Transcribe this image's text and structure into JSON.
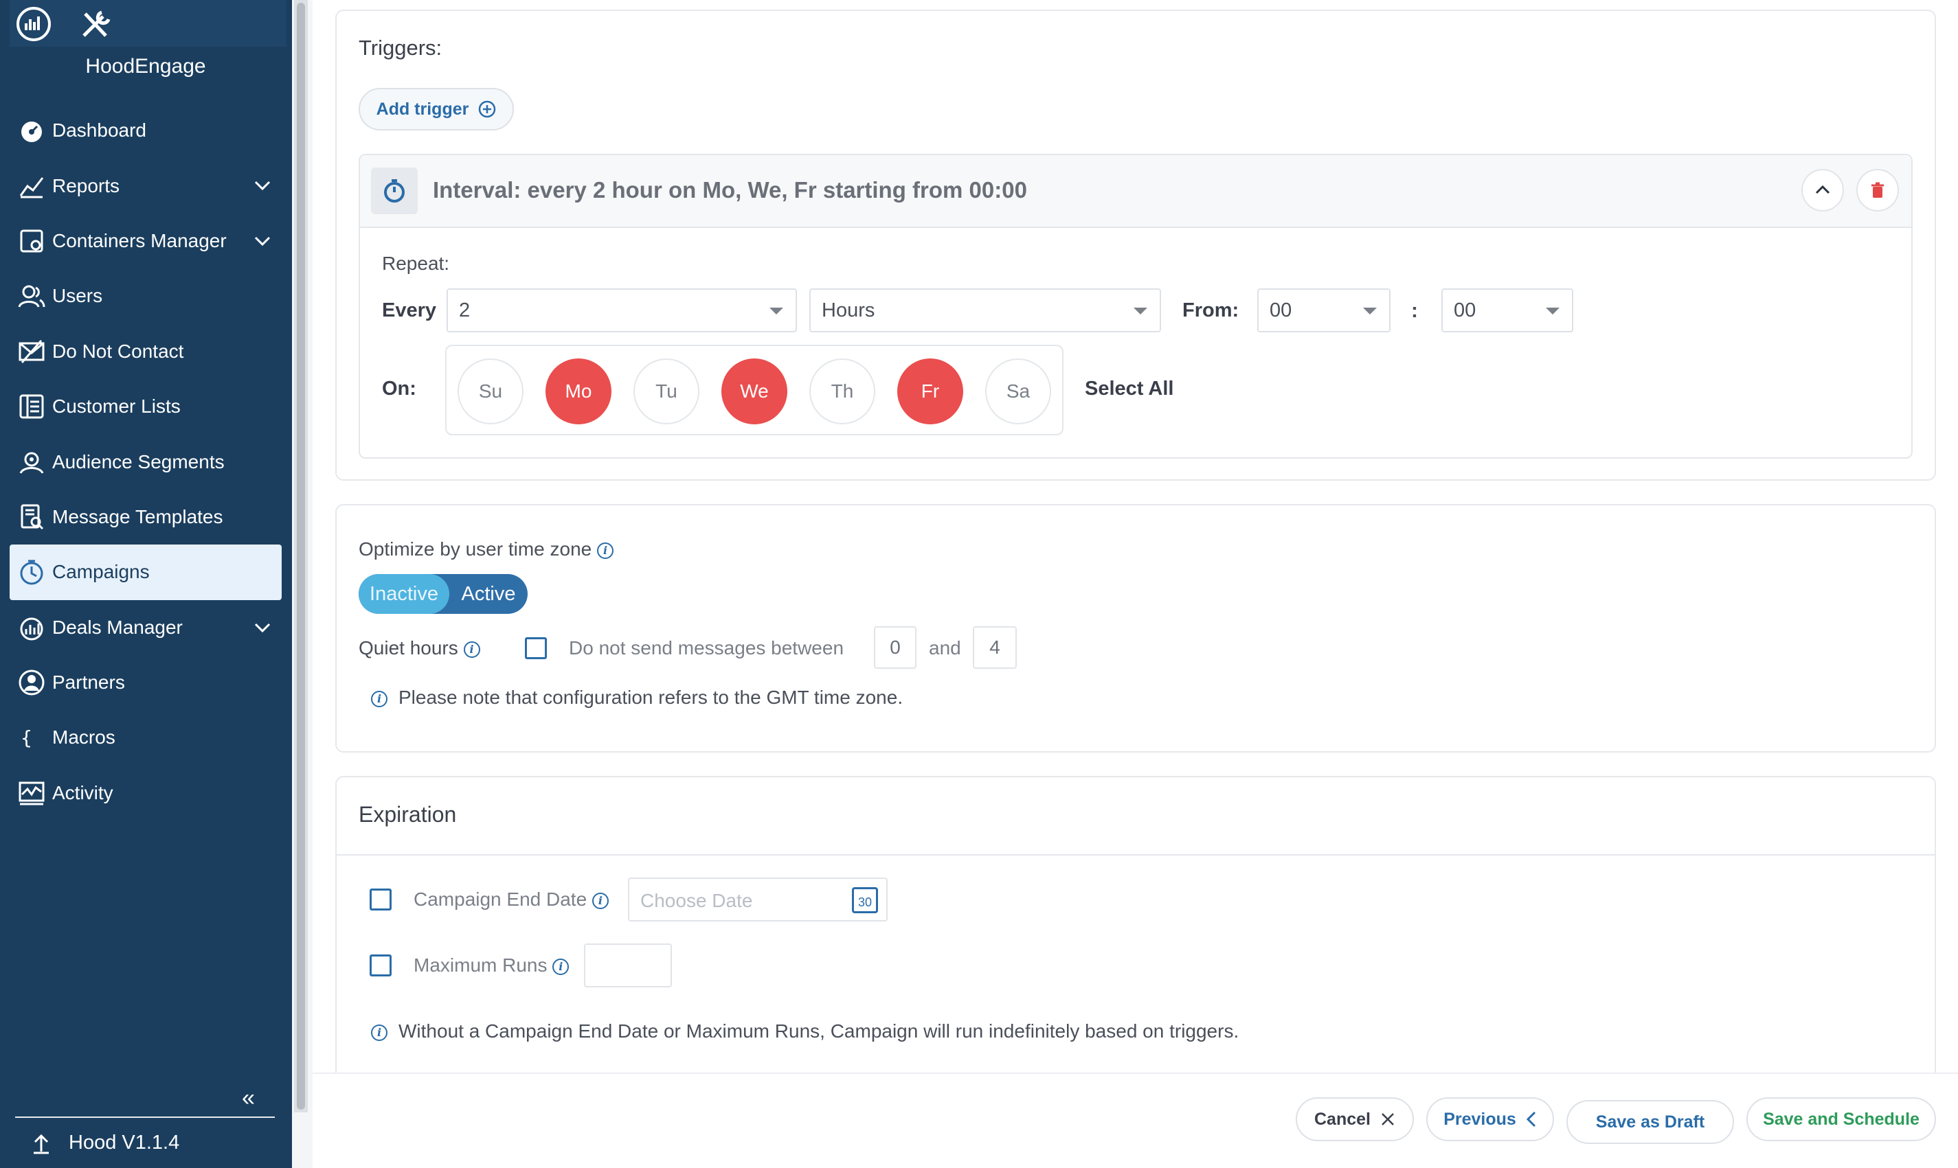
{
  "sidebar": {
    "brand": "HoodEngage",
    "items": [
      {
        "label": "Dashboard",
        "icon": "dashboard-icon",
        "expandable": false
      },
      {
        "label": "Reports",
        "icon": "reports-icon",
        "expandable": true
      },
      {
        "label": "Containers Manager",
        "icon": "containers-icon",
        "expandable": true
      },
      {
        "label": "Users",
        "icon": "users-icon",
        "expandable": false
      },
      {
        "label": "Do Not Contact",
        "icon": "do-not-contact-icon",
        "expandable": false
      },
      {
        "label": "Customer Lists",
        "icon": "customer-lists-icon",
        "expandable": false
      },
      {
        "label": "Audience Segments",
        "icon": "audience-segments-icon",
        "expandable": false
      },
      {
        "label": "Message Templates",
        "icon": "message-templates-icon",
        "expandable": false
      },
      {
        "label": "Campaigns",
        "icon": "campaigns-icon",
        "expandable": false,
        "active": true
      },
      {
        "label": "Deals Manager",
        "icon": "deals-manager-icon",
        "expandable": true
      },
      {
        "label": "Partners",
        "icon": "partners-icon",
        "expandable": false
      },
      {
        "label": "Macros",
        "icon": "macros-icon",
        "expandable": false
      },
      {
        "label": "Activity",
        "icon": "activity-icon",
        "expandable": false
      }
    ],
    "collapse_glyph": "«",
    "version": "Hood V1.1.4"
  },
  "triggers": {
    "title": "Triggers:",
    "add_label": "Add trigger",
    "interval_title": "Interval: every 2 hour on Mo, We, Fr starting from 00:00",
    "repeat_label": "Repeat:",
    "every_label": "Every",
    "every_value": "2",
    "unit_value": "Hours",
    "from_label": "From:",
    "hour_value": "00",
    "colon": ":",
    "minute_value": "00",
    "on_label": "On:",
    "days": [
      {
        "label": "Su",
        "selected": false
      },
      {
        "label": "Mo",
        "selected": true
      },
      {
        "label": "Tu",
        "selected": false
      },
      {
        "label": "We",
        "selected": true
      },
      {
        "label": "Th",
        "selected": false
      },
      {
        "label": "Fr",
        "selected": true
      },
      {
        "label": "Sa",
        "selected": false
      }
    ],
    "select_all": "Select All"
  },
  "optimize": {
    "label": "Optimize by user time zone",
    "toggle_inactive": "Inactive",
    "toggle_active": "Active",
    "quiet_label": "Quiet hours",
    "quiet_text": "Do not send messages between",
    "quiet_from": "0",
    "quiet_and": "and",
    "quiet_to": "4",
    "note": "Please note that configuration refers to the GMT time zone."
  },
  "expiration": {
    "title": "Expiration",
    "end_date_label": "Campaign End Date",
    "date_placeholder": "Choose Date",
    "calendar_day": "30",
    "max_runs_label": "Maximum Runs",
    "note": "Without a Campaign End Date or Maximum Runs, Campaign will run indefinitely based on triggers."
  },
  "footer": {
    "cancel": "Cancel",
    "previous": "Previous",
    "save_draft": "Save as Draft",
    "save_schedule": "Save and Schedule"
  },
  "colors": {
    "sidebar_bg": "#1b3e5e",
    "accent": "#2a6ca8",
    "day_selected": "#ea4e4e",
    "toggle_active": "#4fb3e0",
    "green": "#2e9b5a"
  }
}
